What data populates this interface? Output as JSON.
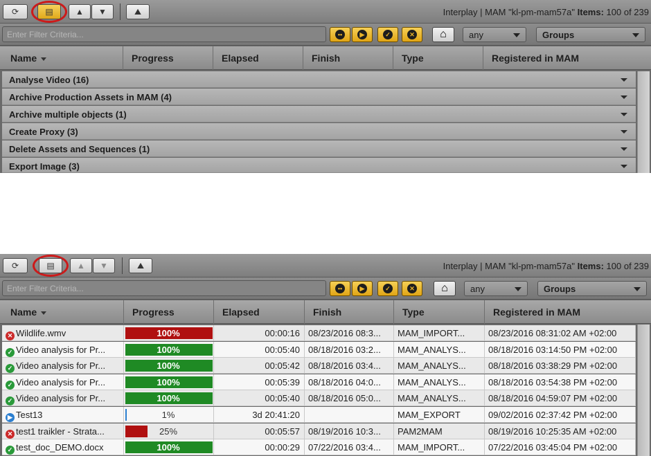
{
  "toolbar": {
    "refresh_icon": "refresh-icon",
    "list_icon": "list-view-icon",
    "up_icon": "up-arrows-icon",
    "down_icon": "down-arrows-icon",
    "image_icon": "image-icon",
    "title_prefix": "Interplay | MAM \"kl-pm-mam57a\"",
    "items_label": "Items:",
    "items_value": "100 of 239"
  },
  "filter": {
    "placeholder": "Enter Filter Criteria...",
    "status_buttons": [
      "waiting",
      "running",
      "completed",
      "failed"
    ],
    "home_icon": "home-icon",
    "status_select": "any",
    "groups_select": "Groups"
  },
  "columns": [
    "Name",
    "Progress",
    "Elapsed",
    "Finish",
    "Type",
    "Registered in MAM"
  ],
  "groups": [
    "Analyse Video (16)",
    "Archive Production Assets in MAM (4)",
    "Archive multiple objects (1)",
    "Create Proxy (3)",
    "Delete Assets and Sequences (1)",
    "Export Image (3)"
  ],
  "rows": [
    {
      "status": "failed",
      "name": "Wildlife.wmv",
      "progress": 100,
      "progress_label": "100%",
      "bar_color": "#b01010",
      "elapsed": "00:00:16",
      "finish": "08/23/2016 08:3...",
      "type": "MAM_IMPORT...",
      "registered": "08/23/2016 08:31:02 AM +02:00"
    },
    {
      "status": "completed",
      "name": "Video analysis for Pr...",
      "progress": 100,
      "progress_label": "100%",
      "bar_color": "#1f8a24",
      "elapsed": "00:05:40",
      "finish": "08/18/2016 03:2...",
      "type": "MAM_ANALYS...",
      "registered": "08/18/2016 03:14:50 PM +02:00"
    },
    {
      "status": "completed",
      "name": "Video analysis for Pr...",
      "progress": 100,
      "progress_label": "100%",
      "bar_color": "#1f8a24",
      "elapsed": "00:05:42",
      "finish": "08/18/2016 03:4...",
      "type": "MAM_ANALYS...",
      "registered": "08/18/2016 03:38:29 PM +02:00"
    },
    {
      "status": "completed",
      "name": "Video analysis for Pr...",
      "progress": 100,
      "progress_label": "100%",
      "bar_color": "#1f8a24",
      "elapsed": "00:05:39",
      "finish": "08/18/2016 04:0...",
      "type": "MAM_ANALYS...",
      "registered": "08/18/2016 03:54:38 PM +02:00"
    },
    {
      "status": "completed",
      "name": "Video analysis for Pr...",
      "progress": 100,
      "progress_label": "100%",
      "bar_color": "#1f8a24",
      "elapsed": "00:05:40",
      "finish": "08/18/2016 05:0...",
      "type": "MAM_ANALYS...",
      "registered": "08/18/2016 04:59:07 PM +02:00"
    },
    {
      "status": "running",
      "name": "Test13",
      "progress": 1,
      "progress_label": "1%",
      "bar_color": "#2b7fd0",
      "elapsed": "3d 20:41:20",
      "finish": "",
      "type": "MAM_EXPORT",
      "registered": "09/02/2016 02:37:42 PM +02:00"
    },
    {
      "status": "failed",
      "name": "test1 traikler - Strata...",
      "progress": 25,
      "progress_label": "25%",
      "bar_color": "#b01010",
      "elapsed": "00:05:57",
      "finish": "08/19/2016 10:3...",
      "type": "PAM2MAM",
      "registered": "08/19/2016 10:25:35 AM +02:00"
    },
    {
      "status": "completed",
      "name": "test_doc_DEMO.docx",
      "progress": 100,
      "progress_label": "100%",
      "bar_color": "#1f8a24",
      "elapsed": "00:00:29",
      "finish": "07/22/2016 03:4...",
      "type": "MAM_IMPORT...",
      "registered": "07/22/2016 03:45:04 PM +02:00"
    }
  ]
}
